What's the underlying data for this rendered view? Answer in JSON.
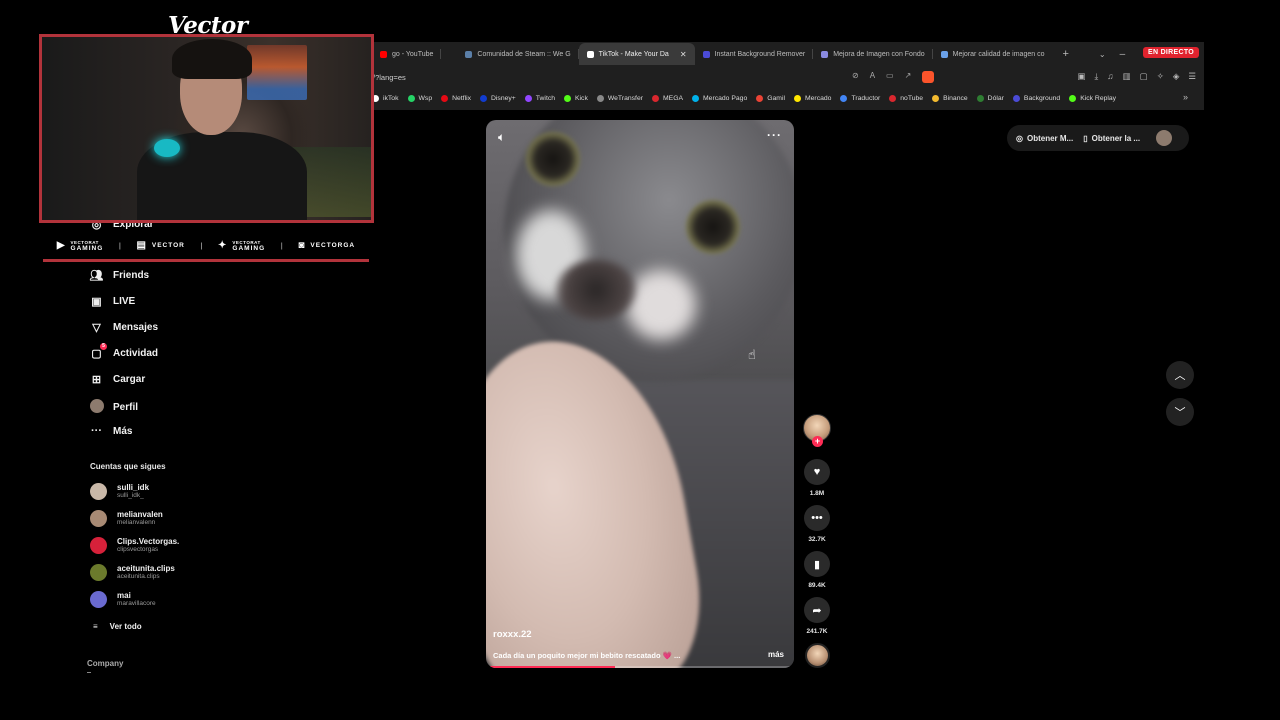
{
  "browser": {
    "tabs": [
      {
        "label": "go - YouTube",
        "active": false,
        "favicon_color": "#ff0000"
      },
      {
        "label": "Comunidad de Steam :: We G",
        "active": false,
        "favicon_color": "#5b7fa8"
      },
      {
        "label": "TikTok - Make Your Da",
        "active": true,
        "favicon_color": "#ffffff"
      },
      {
        "label": "Instant Background Remover",
        "active": false,
        "favicon_color": "#4b4bd6"
      },
      {
        "label": "Mejora de Imagen con Fondo",
        "active": false,
        "favicon_color": "#8a8ae0"
      },
      {
        "label": "Mejorar calidad de imagen co",
        "active": false,
        "favicon_color": "#6aa0e8"
      }
    ],
    "new_tab": "+",
    "live_badge": "EN DIRECTO",
    "url": "/?lang=es",
    "bookmarks": [
      {
        "label": "ikTok",
        "color": "#ffffff"
      },
      {
        "label": "Wsp",
        "color": "#25d366"
      },
      {
        "label": "Netflix",
        "color": "#e50914"
      },
      {
        "label": "Disney+",
        "color": "#113ccf"
      },
      {
        "label": "Twitch",
        "color": "#9146ff"
      },
      {
        "label": "Kick",
        "color": "#53fc18"
      },
      {
        "label": "WeTransfer",
        "color": "#888888"
      },
      {
        "label": "MEGA",
        "color": "#d9272e"
      },
      {
        "label": "Mercado Pago",
        "color": "#00b1ea"
      },
      {
        "label": "Gamil",
        "color": "#ea4335"
      },
      {
        "label": "Mercado",
        "color": "#ffe600"
      },
      {
        "label": "Traductor",
        "color": "#4285f4"
      },
      {
        "label": "noTube",
        "color": "#d9272e"
      },
      {
        "label": "Binance",
        "color": "#f3ba2f"
      },
      {
        "label": "Dólar",
        "color": "#2e7d32"
      },
      {
        "label": "Background",
        "color": "#4b4bd6"
      },
      {
        "label": "Kick Replay",
        "color": "#53fc18"
      }
    ],
    "bookmarks_more": "»"
  },
  "stream_overlay": {
    "streamer_name": "Vector",
    "socials": [
      {
        "icon": "youtube-icon",
        "small": "VECTORAT",
        "label": "GAMING"
      },
      {
        "icon": "twitch-icon",
        "small": "",
        "label": "VECTOR"
      },
      {
        "icon": "twitter-icon",
        "small": "VECTORAT",
        "label": "GAMING"
      },
      {
        "icon": "instagram-icon",
        "small": "",
        "label": "VECTORGA"
      }
    ]
  },
  "sidebar": {
    "nav": [
      {
        "label": "Explorar",
        "icon": "compass-icon"
      },
      {
        "label": "Friends",
        "icon": "friends-icon"
      },
      {
        "label": "LIVE",
        "icon": "live-icon"
      },
      {
        "label": "Mensajes",
        "icon": "messages-icon"
      },
      {
        "label": "Actividad",
        "icon": "activity-icon",
        "badge": "5"
      },
      {
        "label": "Cargar",
        "icon": "upload-icon"
      },
      {
        "label": "Perfil",
        "icon": "profile-avatar"
      },
      {
        "label": "Más",
        "icon": "more-icon"
      }
    ],
    "following_title": "Cuentas que sigues",
    "following": [
      {
        "name": "sulli_idk",
        "handle": "sulli_idk_",
        "color": "#c9b8a8"
      },
      {
        "name": "melianvalen",
        "handle": "melianvalenn",
        "color": "#a88a74"
      },
      {
        "name": "Clips.Vectorgas.",
        "handle": "clipsvectorgas",
        "color": "#d6213a"
      },
      {
        "name": "aceitunita.clips",
        "handle": "aceitunita.clips",
        "color": "#6b7a2c"
      },
      {
        "name": "mai",
        "handle": "maravillacore",
        "color": "#6a6ad0"
      }
    ],
    "see_all": "Ver todo",
    "company": "Company"
  },
  "video": {
    "username": "roxxx.22",
    "caption": "Cada día un poquito mejor mi bebito rescatado 💗 ...",
    "more": "más",
    "progress": 0.42
  },
  "actions": {
    "likes": "1.8M",
    "comments": "32.7K",
    "saves": "89.4K",
    "shares": "241.7K"
  },
  "header_right": {
    "get_app_1": "Obtener M...",
    "get_app_2": "Obtener la ..."
  }
}
